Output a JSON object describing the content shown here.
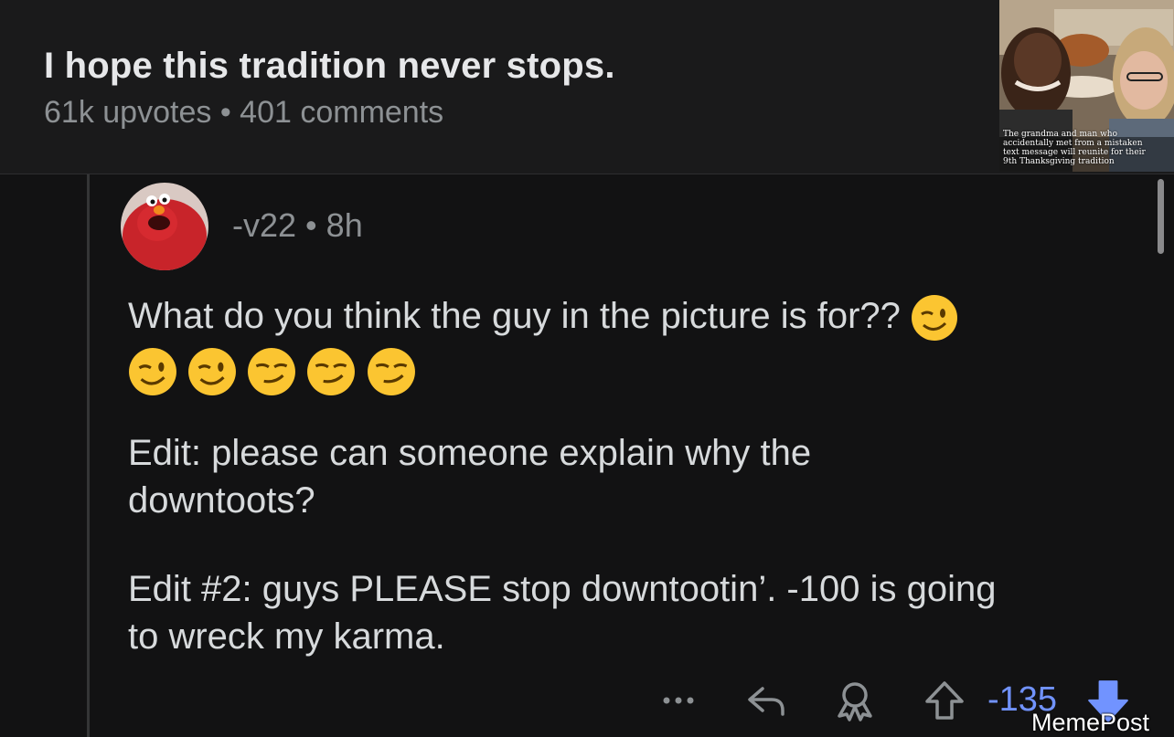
{
  "post": {
    "title": "I hope this tradition never stops.",
    "upvotes": "61k upvotes",
    "separator": "•",
    "comments": "401 comments",
    "thumbnail_caption": "The grandma and man who accidentally met from a mistaken text message will reunite for their 9th Thanksgiving tradition"
  },
  "comment": {
    "username": "-v22",
    "separator": "•",
    "age": "8h",
    "line1": "What do you think the guy in the picture is for??",
    "emojis": [
      "winking-face",
      "winking-face",
      "winking-face",
      "smirking-face",
      "smirking-face",
      "smirking-face"
    ],
    "edit1_line1": "Edit: please can someone explain why the",
    "edit1_line2": "downtoots?",
    "edit2_line1": "Edit #2: guys PLEASE stop downtootin’. -100 is going",
    "edit2_line2": "to wreck my karma.",
    "score": "-135"
  },
  "actions": {
    "more_icon": "more-dots-icon",
    "reply_icon": "reply-icon",
    "award_icon": "award-icon",
    "upvote_icon": "upvote-icon",
    "downvote_icon": "downvote-icon"
  },
  "watermark": "MemePost",
  "colors": {
    "background": "#121213",
    "header": "#1a1a1b",
    "score": "#7193ff",
    "downvote": "#7193ff"
  }
}
